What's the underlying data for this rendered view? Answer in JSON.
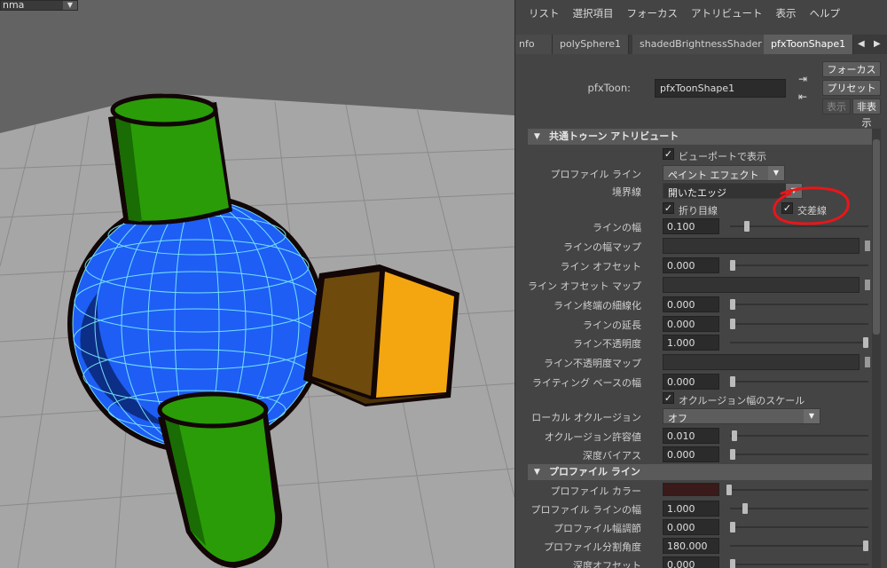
{
  "viewport": {
    "menu_text": "nma",
    "colors": {
      "background": "#636363",
      "grid_plane": "#a8a8a8",
      "sphere": "#1e5ef5",
      "wire": "#7ef0ff",
      "cylinder": "#2a9c08",
      "cube_front": "#f4a611",
      "cube_side": "#6e4a0c",
      "outline": "#120606"
    }
  },
  "menubar": [
    "リスト",
    "選択項目",
    "フォーカス",
    "アトリビュート",
    "表示",
    "ヘルプ"
  ],
  "tabs": [
    "nfo",
    "polySphere1",
    "shadedBrightnessShader",
    "pfxToonShape1"
  ],
  "header": {
    "label": "pfxToon:",
    "name_value": "pfxToonShape1",
    "focus_button": "フォーカス",
    "preset_button": "プリセット",
    "show_button": "表示",
    "hide_button": "非表示"
  },
  "sections": {
    "common": {
      "title": "共通トゥーン アトリビュート",
      "viewport_display": "ビューポートで表示",
      "profile_line_label": "プロファイル ライン",
      "profile_line_value": "ペイント エフェクト",
      "border_label": "境界線",
      "border_value": "開いたエッジ",
      "crease_label": "折り目線",
      "intersection_label": "交差線",
      "line_width_label": "ラインの幅",
      "line_width_value": "0.100",
      "line_width_map_label": "ラインの幅マップ",
      "line_offset_label": "ライン オフセット",
      "line_offset_value": "0.000",
      "line_offset_map_label": "ライン オフセット マップ",
      "line_end_thin_label": "ライン終端の細線化",
      "line_end_thin_value": "0.000",
      "line_extend_label": "ラインの延長",
      "line_extend_value": "0.000",
      "line_opacity_label": "ライン不透明度",
      "line_opacity_value": "1.000",
      "line_opacity_map_label": "ライン不透明度マップ",
      "lighting_width_label": "ライティング ベースの幅",
      "lighting_width_value": "0.000",
      "occlusion_scale_label": "オクルージョン幅のスケール",
      "local_occlusion_label": "ローカル オクルージョン",
      "local_occlusion_value": "オフ",
      "occlusion_tolerance_label": "オクルージョン許容値",
      "occlusion_tolerance_value": "0.010",
      "depth_bias_label": "深度バイアス",
      "depth_bias_value": "0.000"
    },
    "profile": {
      "title": "プロファイル ライン",
      "color_label": "プロファイル カラー",
      "color_value": "#3a1a1a",
      "width_label": "プロファイル ラインの幅",
      "width_value": "1.000",
      "width_mod_label": "プロファイル幅調節",
      "width_mod_value": "0.000",
      "break_angle_label": "プロファイル分割角度",
      "break_angle_value": "180.000",
      "depth_offset_label": "深度オフセット",
      "depth_offset_value": "0.000"
    }
  }
}
